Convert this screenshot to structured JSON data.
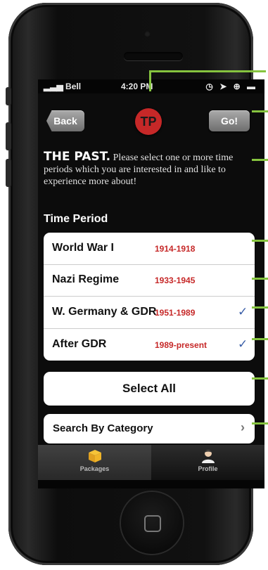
{
  "status_bar": {
    "carrier": "Bell",
    "time": "4:20 PM",
    "icons": "◷ ➤ ⊕ ▬"
  },
  "nav": {
    "back_label": "Back",
    "go_label": "Go!",
    "logo_text": "TP"
  },
  "intro": {
    "heading": "THE PAST.",
    "body": "Please select one or more time periods which you are interested in and like to experience more about!"
  },
  "section_title": "Time Period",
  "periods": [
    {
      "name": "World War I",
      "years": "1914-1918",
      "checked": false
    },
    {
      "name": "Nazi Regime",
      "years": "1933-1945",
      "checked": false
    },
    {
      "name": "W. Germany & GDR",
      "years": "1951-1989",
      "checked": true
    },
    {
      "name": "After GDR",
      "years": "1989-present",
      "checked": true
    }
  ],
  "select_all_label": "Select All",
  "search_category_label": "Search By Category",
  "tabs": [
    {
      "label": "Packages",
      "icon": "box-icon"
    },
    {
      "label": "Profile",
      "icon": "person-icon"
    }
  ],
  "colors": {
    "accent_red": "#c62828",
    "check_blue": "#3a5ea8",
    "callout_green": "#86c43f"
  }
}
